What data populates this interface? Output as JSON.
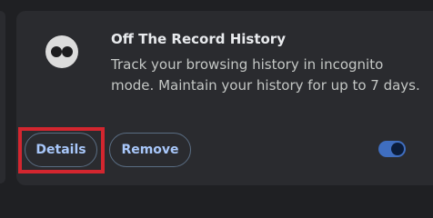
{
  "extension": {
    "icon": "incognito-eyes-icon",
    "title": "Off The Record History",
    "description": "Track your browsing history in incognito mode. Maintain your history for up to 7 days.",
    "details_label": "Details",
    "remove_label": "Remove",
    "enabled": true
  },
  "highlight": {
    "target": "details-button",
    "color": "#d3262f"
  },
  "colors": {
    "background": "#1f2023",
    "card": "#2a2b2f",
    "accent": "#a8c7fa",
    "toggle_on": "#3f6ec0"
  }
}
